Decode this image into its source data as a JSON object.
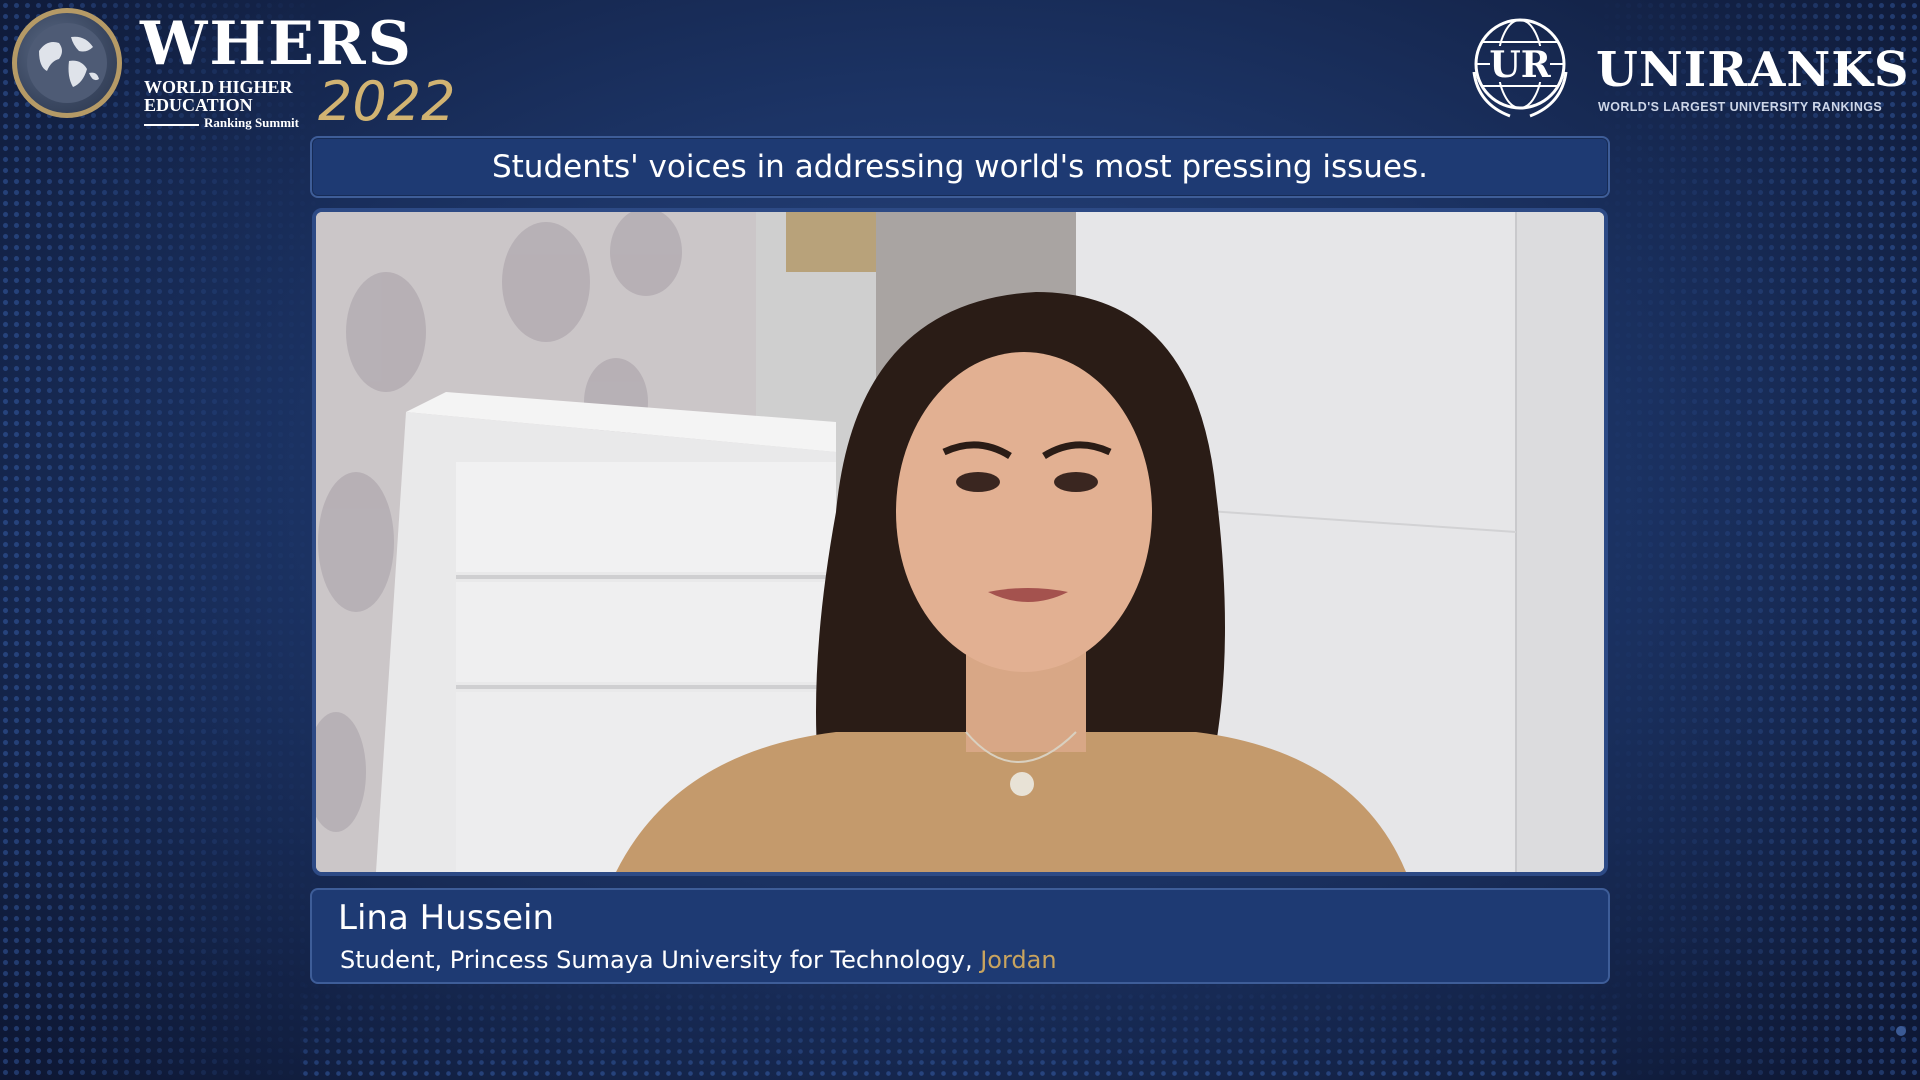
{
  "whers_logo": {
    "word": "WHERS",
    "sub_line1": "WORLD HIGHER",
    "sub_line2": "EDUCATION",
    "sub_line3": "Ranking Summit",
    "year": "2022"
  },
  "uniranks_logo": {
    "emblem_text": "UR",
    "word": "UNIRANKS",
    "tagline": "WORLD'S LARGEST UNIVERSITY RANKINGS"
  },
  "session_title": "Students' voices in addressing world's most pressing issues.",
  "speaker": {
    "name": "Lina Hussein",
    "role": "Student, Princess Sumaya University for Technology, ",
    "country": "Jordan"
  },
  "colors": {
    "panel_bg": "#1e3a73",
    "accent_gold": "#c9a45f",
    "background_dark": "#111e3f"
  }
}
